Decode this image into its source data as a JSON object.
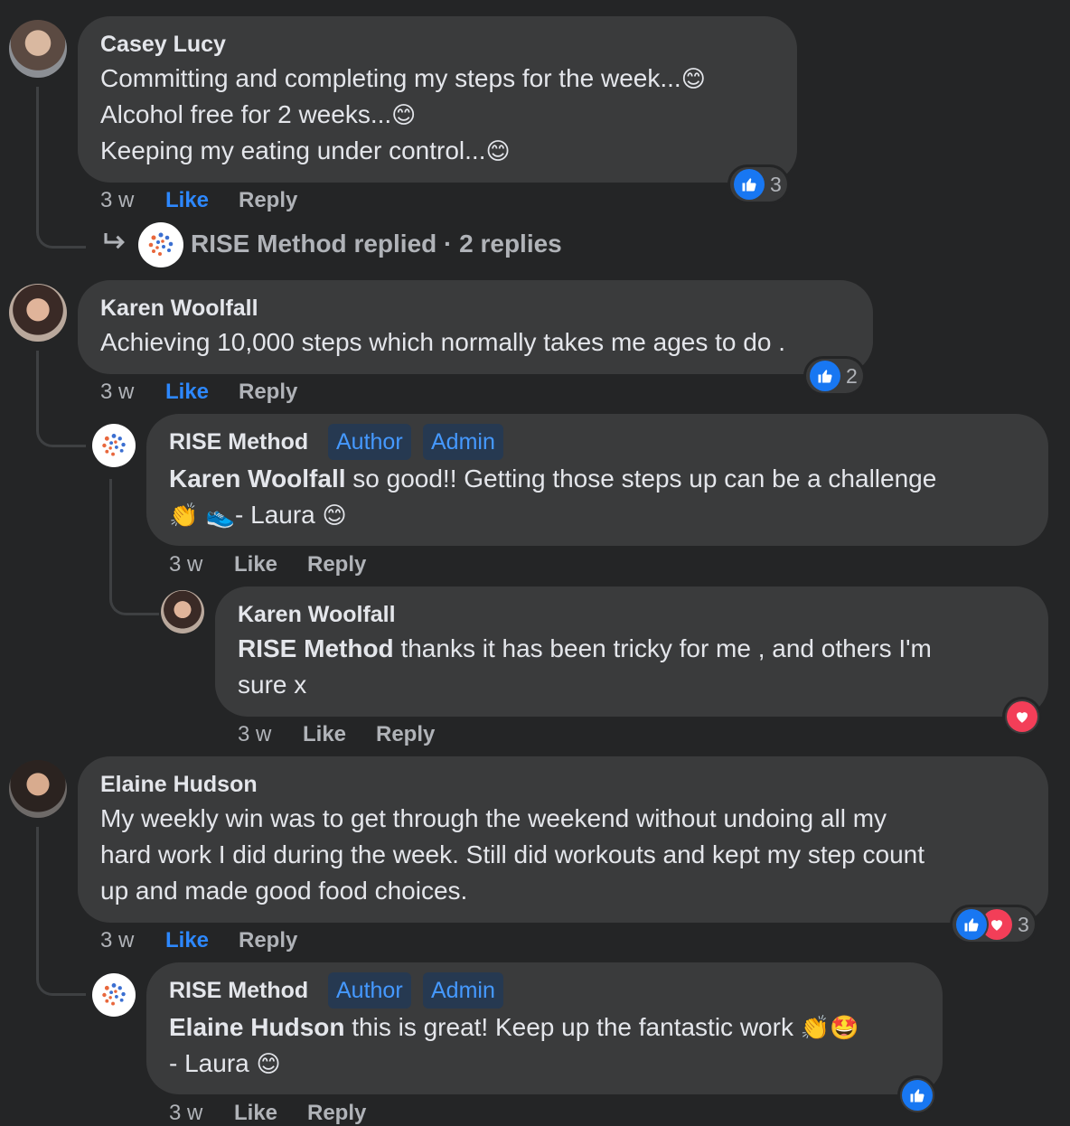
{
  "comments": [
    {
      "author": "Casey Lucy",
      "lines": [
        "Committing and completing my steps for the week...",
        "Alcohol free for 2 weeks...",
        "Keeping my eating under control..."
      ],
      "emojis": [
        "😊",
        "😊",
        "😊"
      ],
      "time": "3 w",
      "like": "Like",
      "reply": "Reply",
      "reaction_count": "3",
      "reactions": [
        "like-icon"
      ]
    },
    {
      "author": "Karen Woolfall",
      "lines": [
        "Achieving 10,000 steps which normally takes me ages to do ."
      ],
      "time": "3 w",
      "like": "Like",
      "reply": "Reply",
      "reaction_count": "2",
      "reactions": [
        "like-icon"
      ]
    },
    {
      "author": "Elaine Hudson",
      "lines": [
        "My weekly win was to get through the weekend without undoing all my",
        "hard work I did during the week. Still did workouts and kept my step count",
        "up and made good food choices."
      ],
      "time": "3 w",
      "like": "Like",
      "reply": "Reply",
      "reaction_count": "3",
      "reactions": [
        "like-icon",
        "heart-icon"
      ]
    }
  ],
  "replies_summary": {
    "text": "RISE Method replied · 2 replies"
  },
  "replies": [
    {
      "author": "RISE Method",
      "badges": [
        "Author",
        "Admin"
      ],
      "mention": "Karen Woolfall",
      "line1": " so good!! Getting those steps up can be a challenge",
      "line2_emoji": "👏 👟",
      "line2": "- Laura",
      "line2_end": "😊",
      "time": "3 w",
      "like": "Like",
      "reply": "Reply"
    },
    {
      "author": "Karen Woolfall",
      "mention": "RISE Method",
      "line1": " thanks it has been tricky for me , and others I'm",
      "line2": "sure x",
      "time": "3 w",
      "like": "Like",
      "reply": "Reply",
      "reactions": [
        "heart-icon"
      ]
    },
    {
      "author": "RISE Method",
      "badges": [
        "Author",
        "Admin"
      ],
      "mention": "Elaine Hudson",
      "line1": " this is great! Keep up the fantastic work",
      "line1_emoji": "👏🤩",
      "line2": "- Laura",
      "line2_end": "😊",
      "time": "3 w",
      "like": "Like",
      "reply": "Reply",
      "reactions": [
        "like-icon"
      ]
    }
  ],
  "colors": {
    "background": "#242526",
    "bubble": "#3a3b3c",
    "like_blue": "#2d88ff",
    "badge_text": "#4599ff",
    "heart": "#f33e58"
  }
}
